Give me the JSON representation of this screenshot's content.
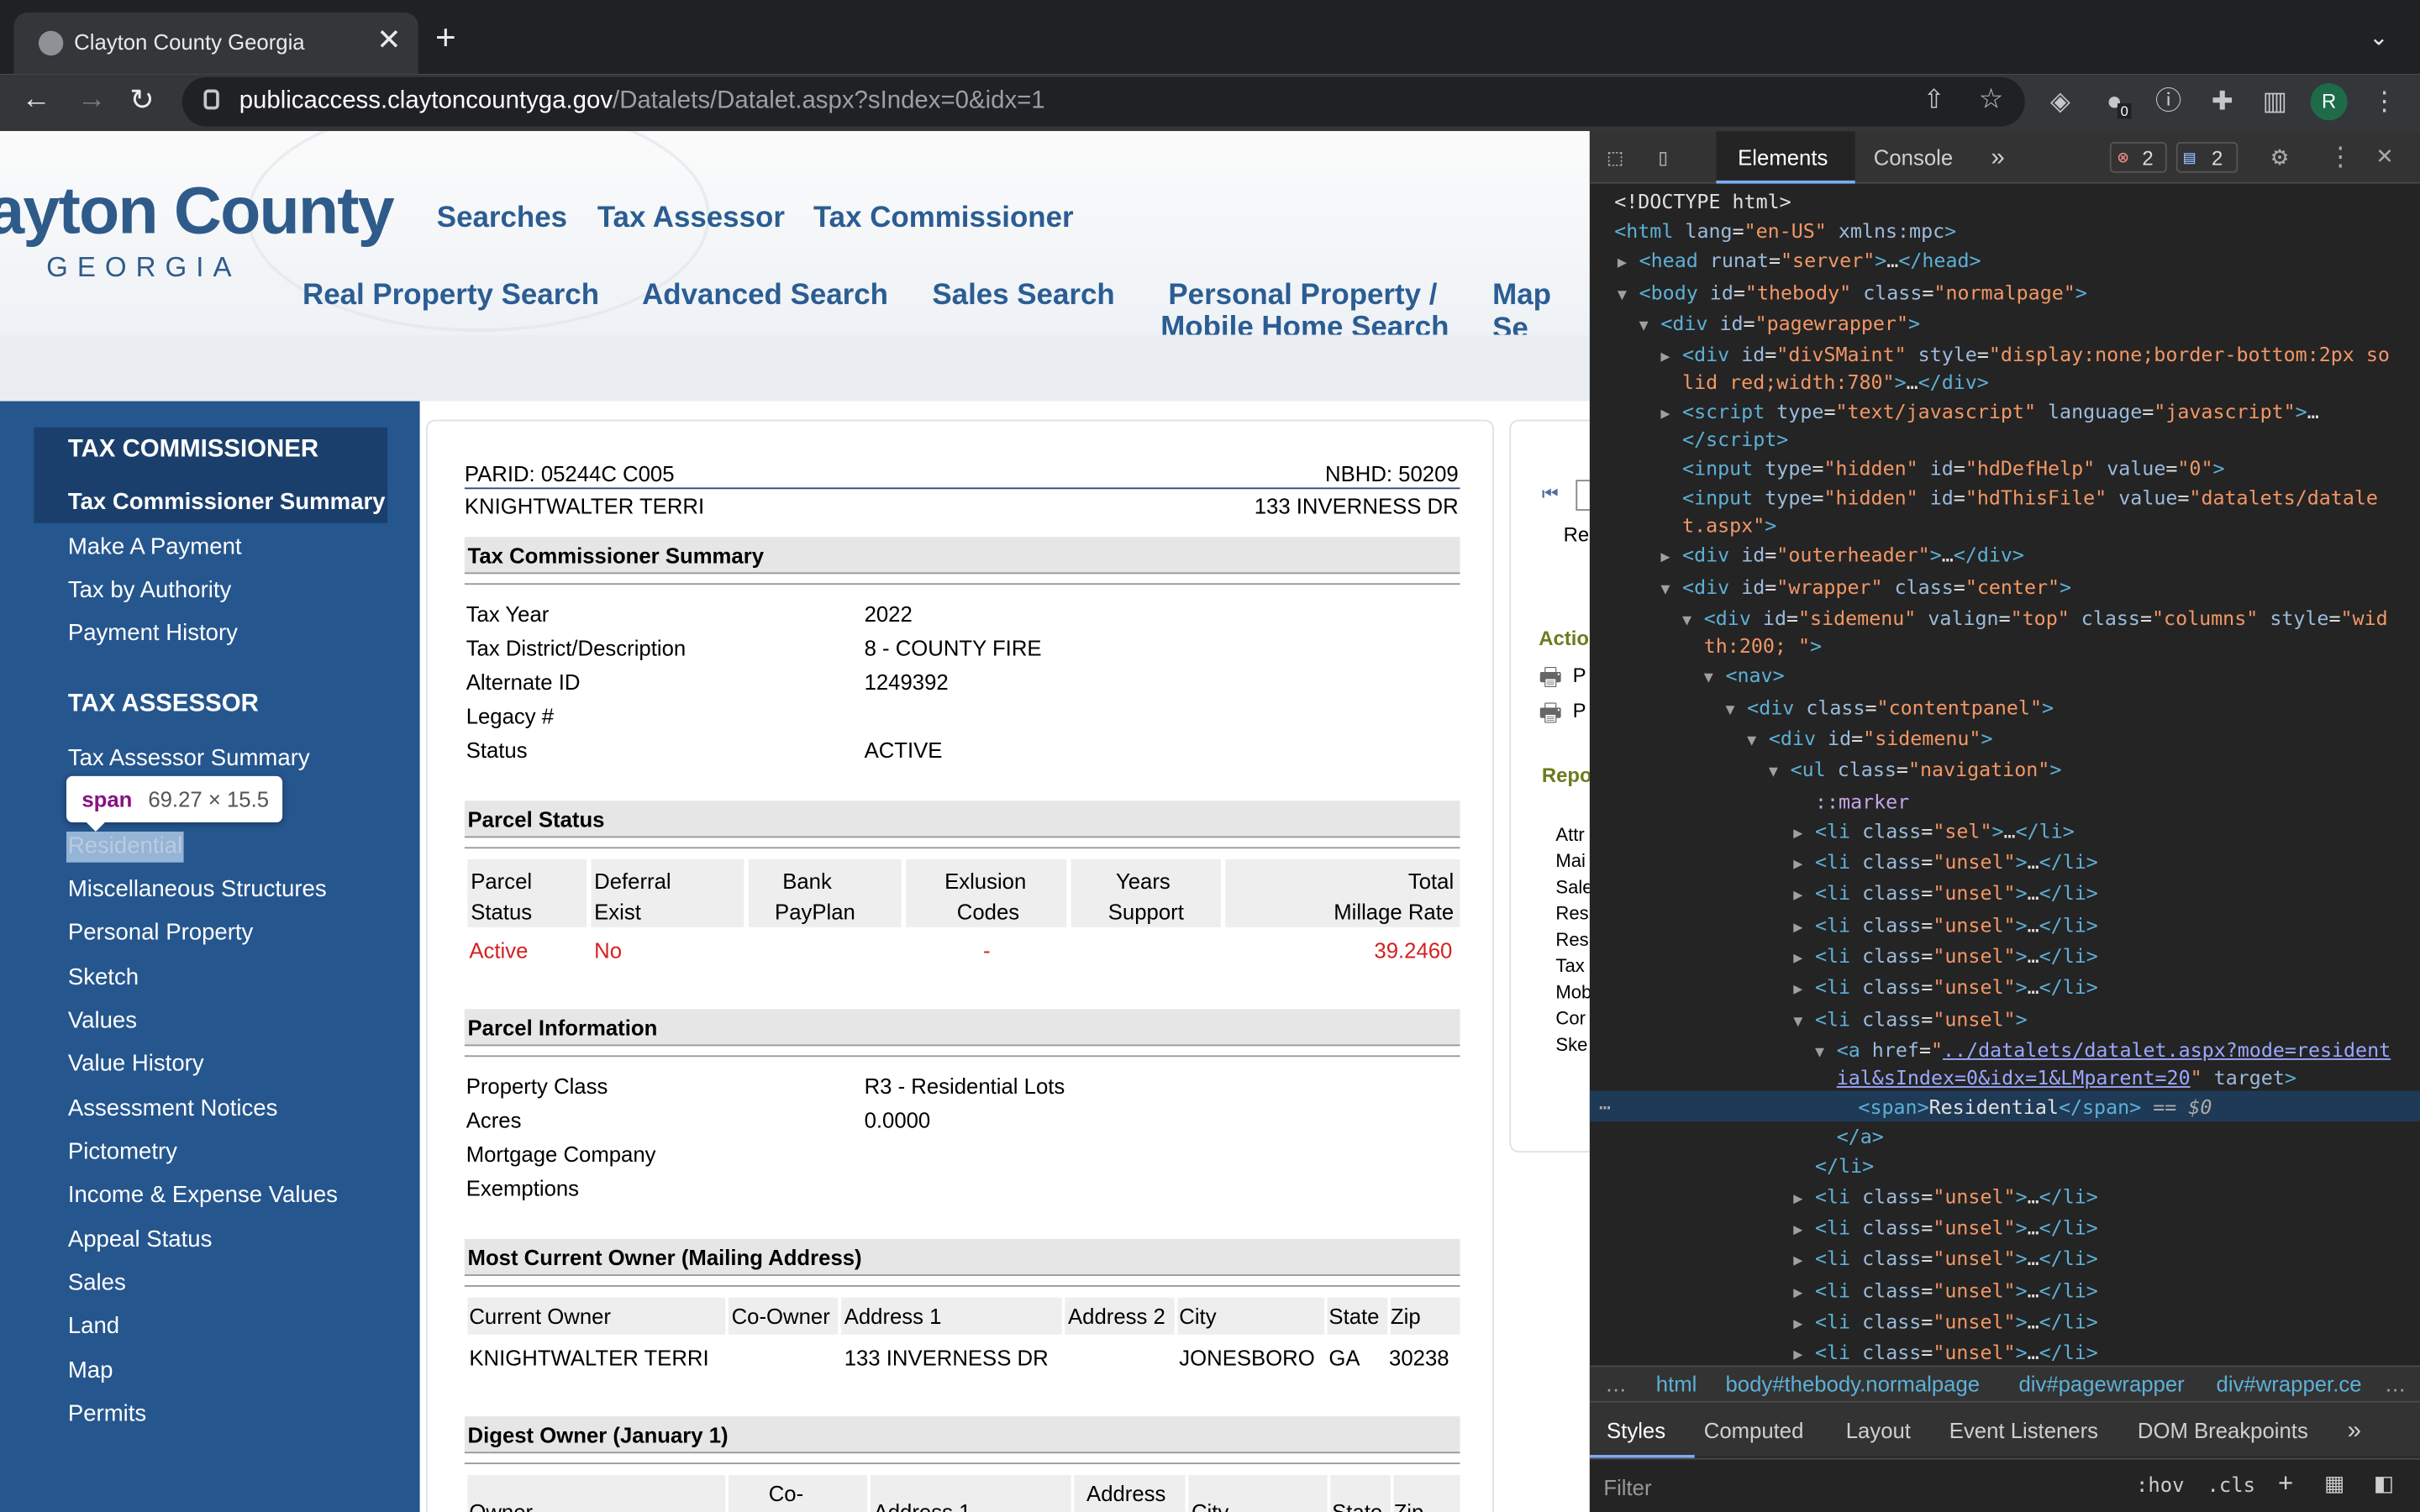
{
  "browser": {
    "tab_title": "Clayton County Georgia",
    "url_host": "publicaccess.claytoncountyga.gov",
    "url_path": "/Datalets/Datalet.aspx?sIndex=0&idx=1",
    "ext_badge": "0",
    "profile_initial": "R"
  },
  "header": {
    "logo_line1": "ayton County",
    "logo_line2": "GEORGIA",
    "nav_top": [
      "Searches",
      "Tax Assessor",
      "Tax Commissioner"
    ],
    "nav_bottom": [
      "Real Property Search",
      "Advanced Search",
      "Sales Search",
      "Personal Property /",
      "Mobile Home Search",
      "Map Se"
    ]
  },
  "sidebar": {
    "section1": "TAX COMMISSIONER",
    "selected": "Tax Commissioner Summary",
    "items1": [
      "Make A Payment",
      "Tax by Authority",
      "Payment History"
    ],
    "section2": "TAX ASSESSOR",
    "items2": [
      "Tax Assessor Summary",
      "Residential",
      "Miscellaneous Structures",
      "Personal Property",
      "Sketch",
      "Values",
      "Value History",
      "Assessment Notices",
      "Pictometry",
      "Income & Expense Values",
      "Appeal Status",
      "Sales",
      "Land",
      "Map",
      "Permits"
    ]
  },
  "tooltip": {
    "tag": "span",
    "size": "69.27 × 15.5"
  },
  "parcel": {
    "parid": "PARID: 05244C C005",
    "nbhd": "NBHD: 50209",
    "owner": "KNIGHTWALTER TERRI",
    "address": "133 INVERNESS DR"
  },
  "tcs": {
    "title": "Tax Commissioner Summary",
    "rows": [
      [
        "Tax Year",
        "2022"
      ],
      [
        "Tax District/Description",
        "8 - COUNTY FIRE"
      ],
      [
        "Alternate ID",
        "1249392"
      ],
      [
        "Legacy #",
        ""
      ],
      [
        "Status",
        "ACTIVE"
      ]
    ]
  },
  "parcel_status": {
    "title": "Parcel Status",
    "headers": [
      [
        "Parcel",
        "Status"
      ],
      [
        "Deferral",
        "Exist"
      ],
      [
        "Bank",
        "PayPlan"
      ],
      [
        "Exlusion",
        "Codes"
      ],
      [
        "Years",
        "Support"
      ],
      [
        "Total",
        "Millage Rate"
      ]
    ],
    "values": [
      "Active",
      "No",
      "",
      "-",
      "",
      "39.2460"
    ]
  },
  "parcel_info": {
    "title": "Parcel Information",
    "rows": [
      [
        "Property Class",
        "R3 - Residential Lots"
      ],
      [
        "Acres",
        "0.0000"
      ],
      [
        "Mortgage Company",
        ""
      ],
      [
        "Exemptions",
        ""
      ]
    ]
  },
  "owner_tbl": {
    "title": "Most Current Owner (Mailing Address)",
    "headers": [
      "Current Owner",
      "Co-Owner",
      "Address 1",
      "Address 2",
      "City",
      "State",
      "Zip"
    ],
    "values": [
      "KNIGHTWALTER TERRI",
      "",
      "133 INVERNESS DR",
      "",
      "JONESBORO",
      "GA",
      "30238"
    ]
  },
  "digest": {
    "title": "Digest Owner (January 1)",
    "headers": [
      "Owner",
      "Co-",
      "Address 1",
      "Address",
      "City",
      "State",
      "Zip"
    ]
  },
  "right": {
    "re": "Re",
    "actions": "Actio",
    "p1": "P",
    "p2": "P",
    "reports": "Repo",
    "items": [
      "Attr",
      "Mai",
      "Sale",
      "Res",
      "Res",
      "Tax",
      "Mob",
      "Cor",
      "Ske"
    ]
  },
  "devtools": {
    "tabs": [
      "Elements",
      "Console"
    ],
    "errors": "2",
    "messages": "2",
    "crumbs": [
      "html",
      "body#thebody.normalpage",
      "div#pagewrapper",
      "div#wrapper.ce"
    ],
    "style_tabs": [
      "Styles",
      "Computed",
      "Layout",
      "Event Listeners",
      "DOM Breakpoints"
    ],
    "filter": "Filter",
    "hov": ":hov",
    ".cls": ".cls"
  }
}
